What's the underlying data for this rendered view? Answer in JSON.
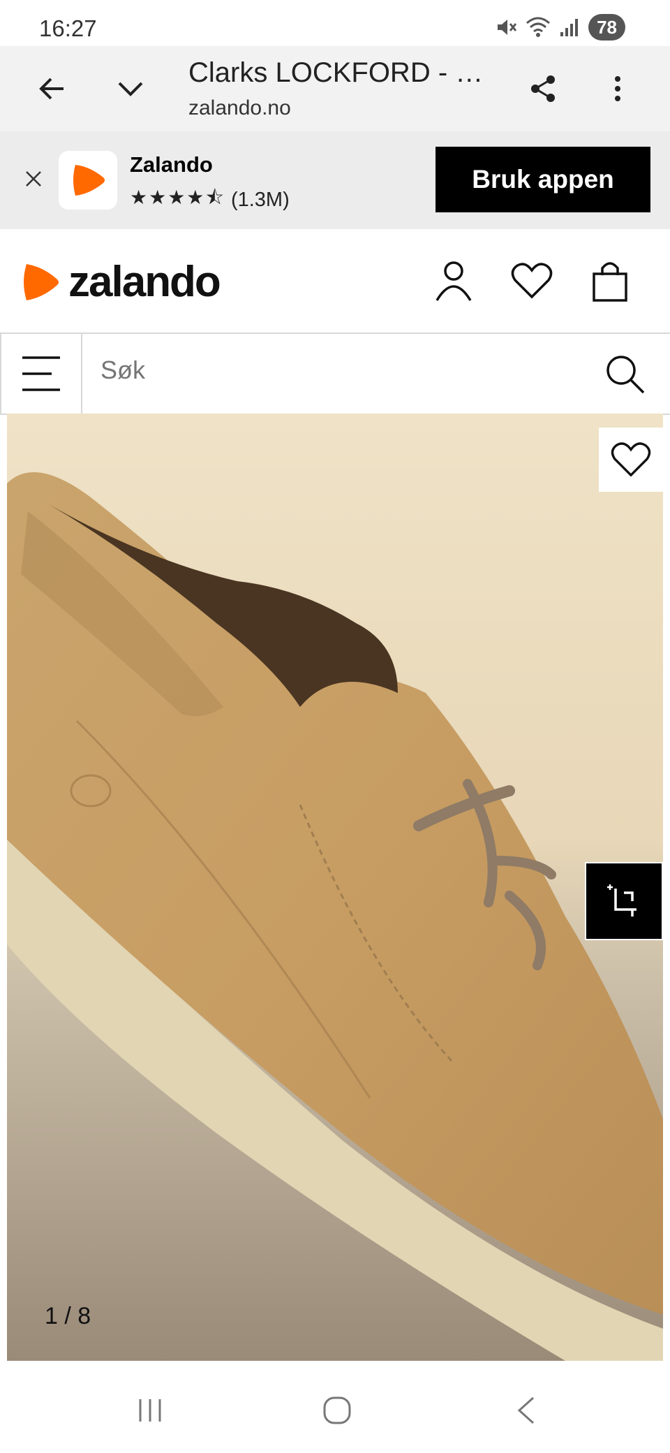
{
  "status": {
    "time": "16:27",
    "battery": "78"
  },
  "browser": {
    "title": "Clarks LOCKFORD - …",
    "domain": "zalando.no"
  },
  "app_banner": {
    "name": "Zalando",
    "stars": "★★★★⯪",
    "rating": "(1.3M)",
    "cta": "Bruk appen"
  },
  "site": {
    "logo_text": "zalando",
    "brand_color": "#ff6900"
  },
  "search": {
    "placeholder": "Søk"
  },
  "product": {
    "image_counter": "1 / 8"
  }
}
